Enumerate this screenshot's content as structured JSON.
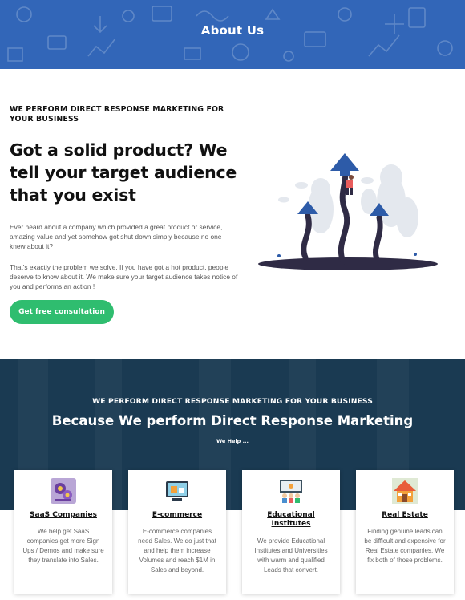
{
  "banner": {
    "title": "About Us",
    "bg_color": "#3266b8"
  },
  "hero": {
    "kicker": "WE PERFORM DIRECT RESPONSE MARKETING FOR YOUR BUSINESS",
    "headline": "Got a solid product? We tell your target audience that you exist",
    "paragraph1": "Ever heard about a company which provided a great product or service, amazing value and yet somehow got shut down simply because no one knew about it?",
    "paragraph2": "That's exactly the problem we solve. If you have got a hot product, people deserve to know about it. We make sure your target audience takes notice of you and performs an action !",
    "cta_label": "Get free consultation",
    "cta_color": "#2fbd6f",
    "illustration": "growth-arrows-illustration"
  },
  "services": {
    "kicker": "WE PERFORM DIRECT RESPONSE MARKETING FOR YOUR BUSINESS",
    "title": "Because We perform Direct Response Marketing",
    "subtitle": "We Help ...",
    "bg_color": "#1a3a52",
    "cards": [
      {
        "icon": "saas-gears-icon",
        "title": "SaaS Companies",
        "text": "We help get SaaS companies get more Sign Ups / Demos and make sure they translate into Sales."
      },
      {
        "icon": "ecommerce-store-icon",
        "title": "E-commerce",
        "text": "E-commerce companies need Sales. We do just that and help them increase Volumes and reach $1M in Sales and beyond."
      },
      {
        "icon": "education-classroom-icon",
        "title": "Educational Institutes",
        "text": "We provide Educational Institutes and Universities with warm and qualified Leads that convert."
      },
      {
        "icon": "house-icon",
        "title": "Real Estate",
        "text": "Finding genuine leads can be difficult and expensive for Real Estate companies. We fix both of those problems."
      }
    ]
  }
}
